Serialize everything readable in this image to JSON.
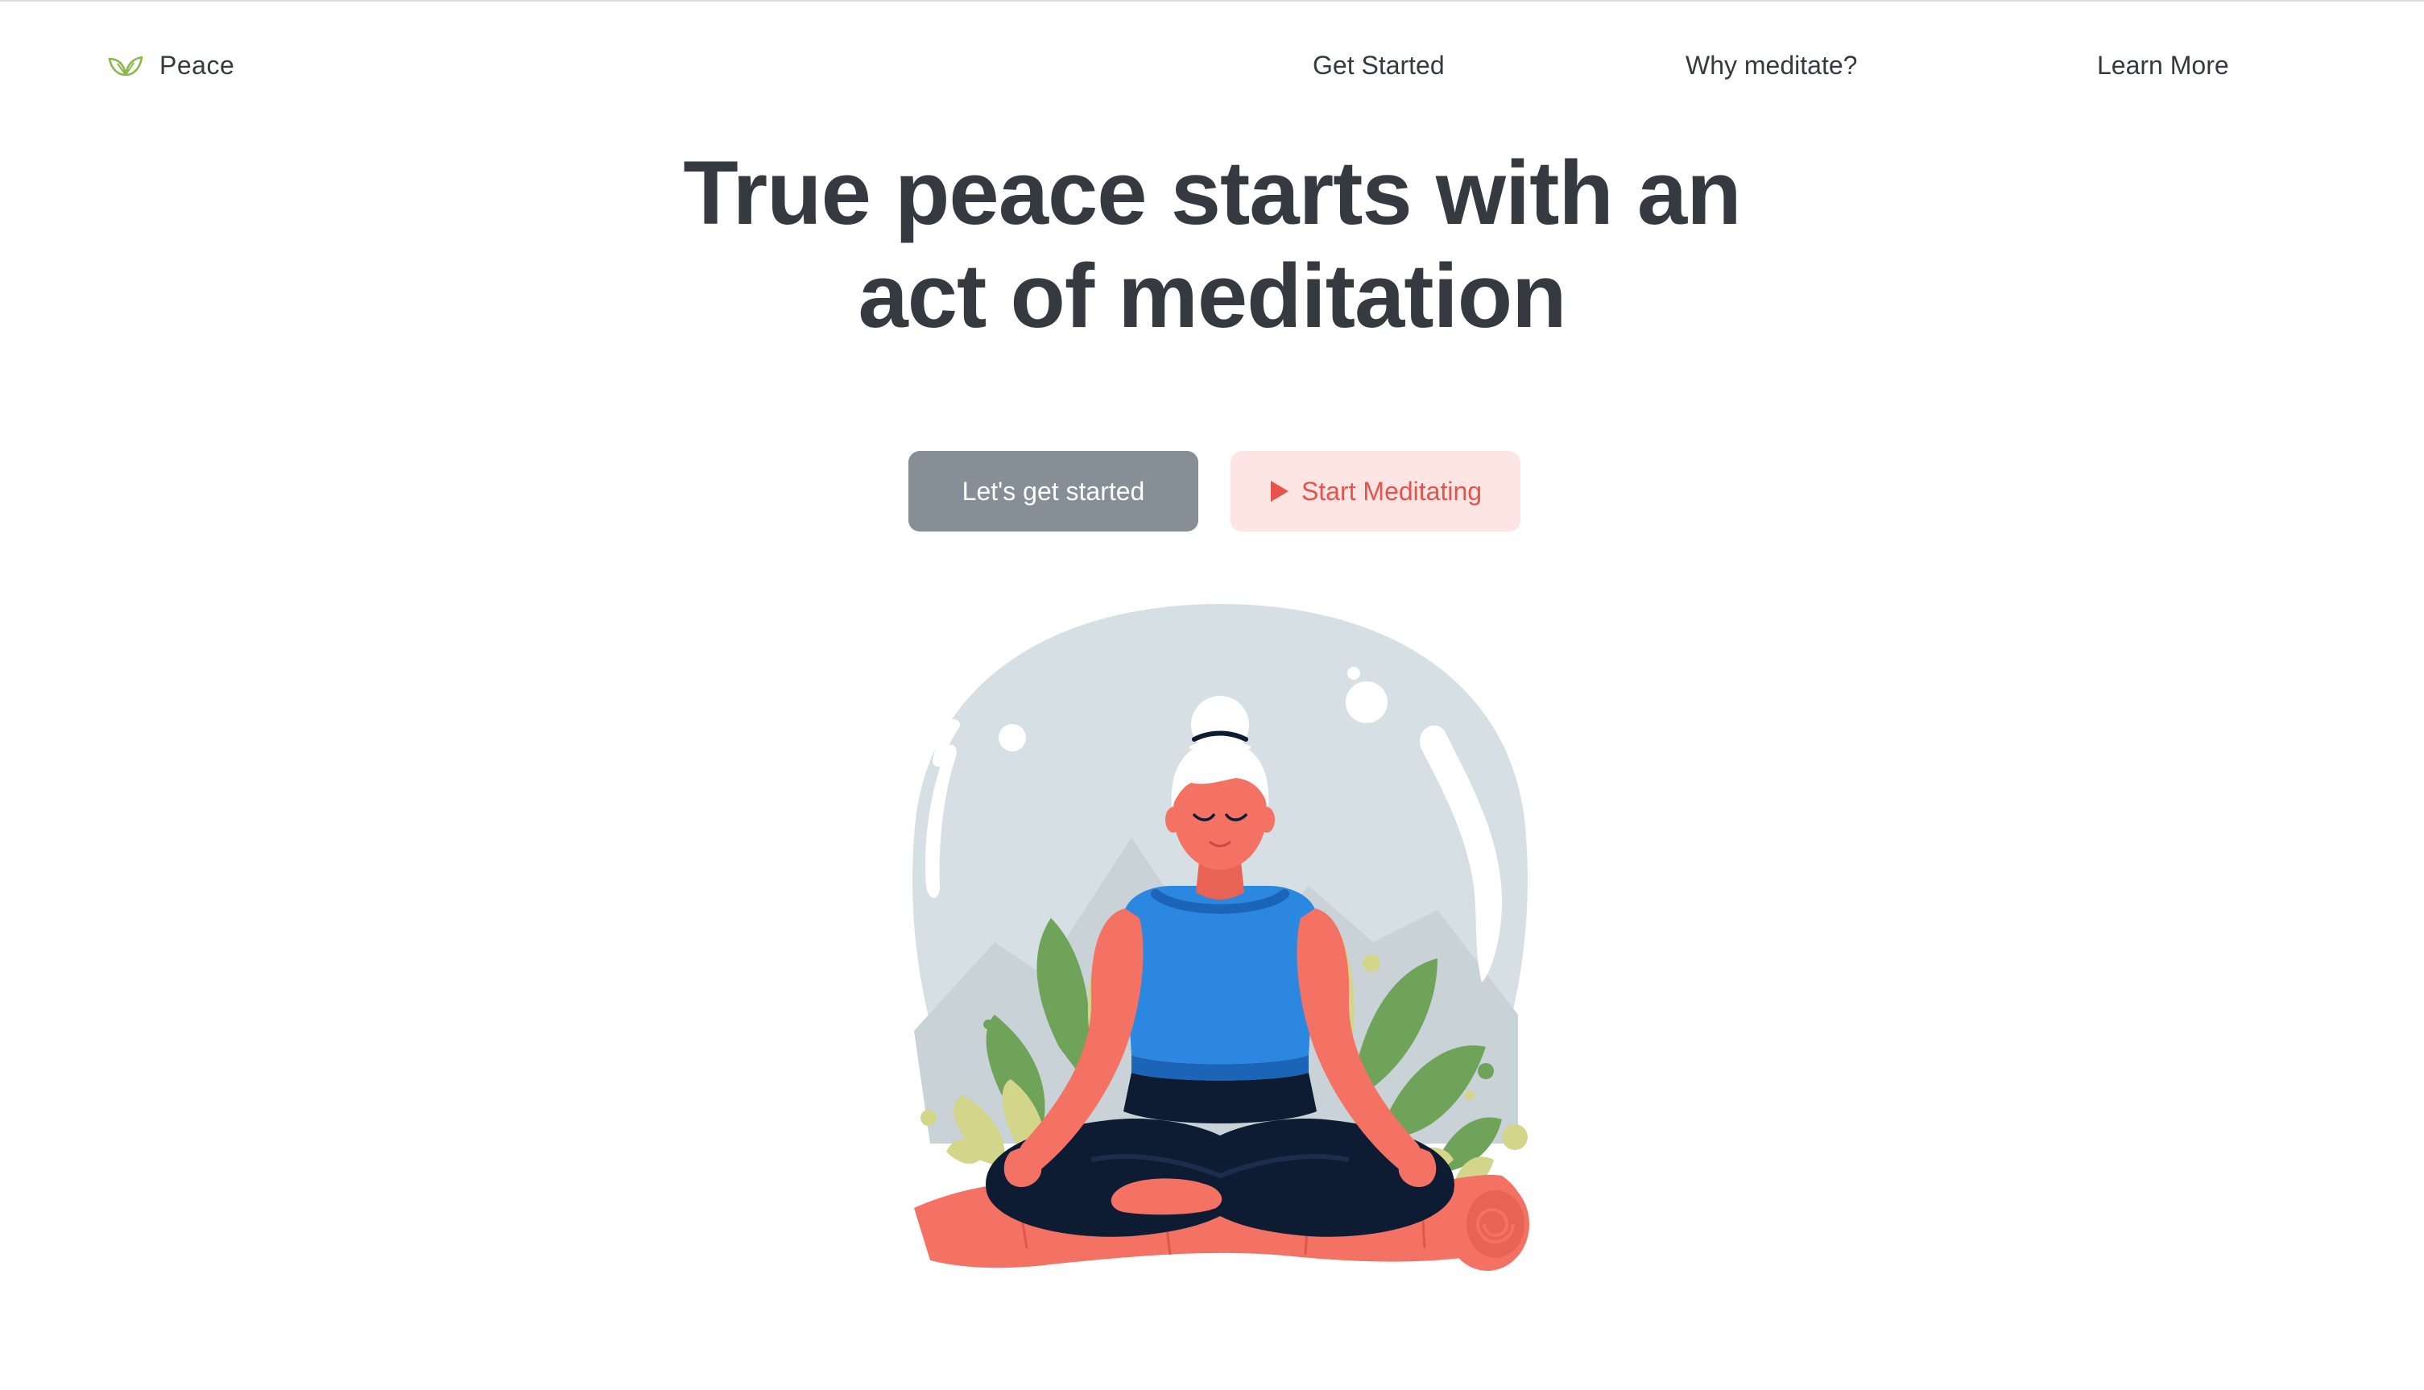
{
  "brand": {
    "name": "Peace",
    "icon": "leaf-icon",
    "icon_color": "#8ab84a"
  },
  "nav": {
    "links": [
      {
        "label": "Get Started"
      },
      {
        "label": "Why meditate?"
      },
      {
        "label": "Learn More"
      }
    ]
  },
  "hero": {
    "title_line1": "True peace starts with an",
    "title_line2": "act of meditation"
  },
  "actions": {
    "primary_label": "Let's get started",
    "secondary_label": "Start Meditating",
    "secondary_icon": "play-icon"
  },
  "colors": {
    "text": "#343a40",
    "primary_button_bg": "#868e96",
    "secondary_button_bg": "#fde5e4",
    "secondary_button_text": "#e5534b",
    "bubble": "#d6dfe3",
    "skin": "#f47264",
    "shirt": "#2b87e0",
    "pants": "#0d1b33",
    "leaf_green": "#6fa35a",
    "leaf_yellow": "#d3d68a"
  },
  "illustration": {
    "subject": "meditating-woman"
  }
}
